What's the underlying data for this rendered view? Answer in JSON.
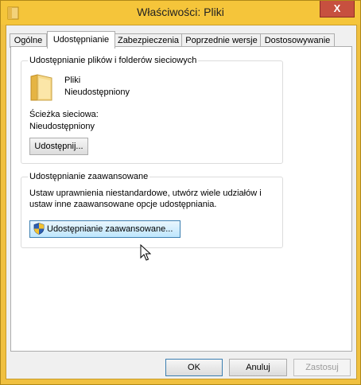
{
  "window": {
    "title": "Właściwości: Pliki",
    "close_glyph": "X"
  },
  "tabs": [
    {
      "label": "Ogólne"
    },
    {
      "label": "Udostępnianie",
      "active": true
    },
    {
      "label": "Zabezpieczenia"
    },
    {
      "label": "Poprzednie wersje"
    },
    {
      "label": "Dostosowywanie"
    }
  ],
  "network_sharing": {
    "legend": "Udostępnianie plików i folderów sieciowych",
    "folder_name": "Pliki",
    "folder_status": "Nieudostępniony",
    "path_label": "Ścieżka sieciowa:",
    "path_value": "Nieudostępniony",
    "share_button": "Udostępnij..."
  },
  "advanced_sharing": {
    "legend": "Udostępnianie zaawansowane",
    "description_line1": "Ustaw uprawnienia niestandardowe, utwórz wiele udziałów i",
    "description_line2": "ustaw inne zaawansowane opcje udostępniania.",
    "button": "Udostępnianie zaawansowane..."
  },
  "footer": {
    "ok": "OK",
    "cancel": "Anuluj",
    "apply": "Zastosuj"
  },
  "colors": {
    "title_bar": "#f5c53a",
    "close_button": "#c7503f",
    "selection_border": "#3c7fb1"
  }
}
